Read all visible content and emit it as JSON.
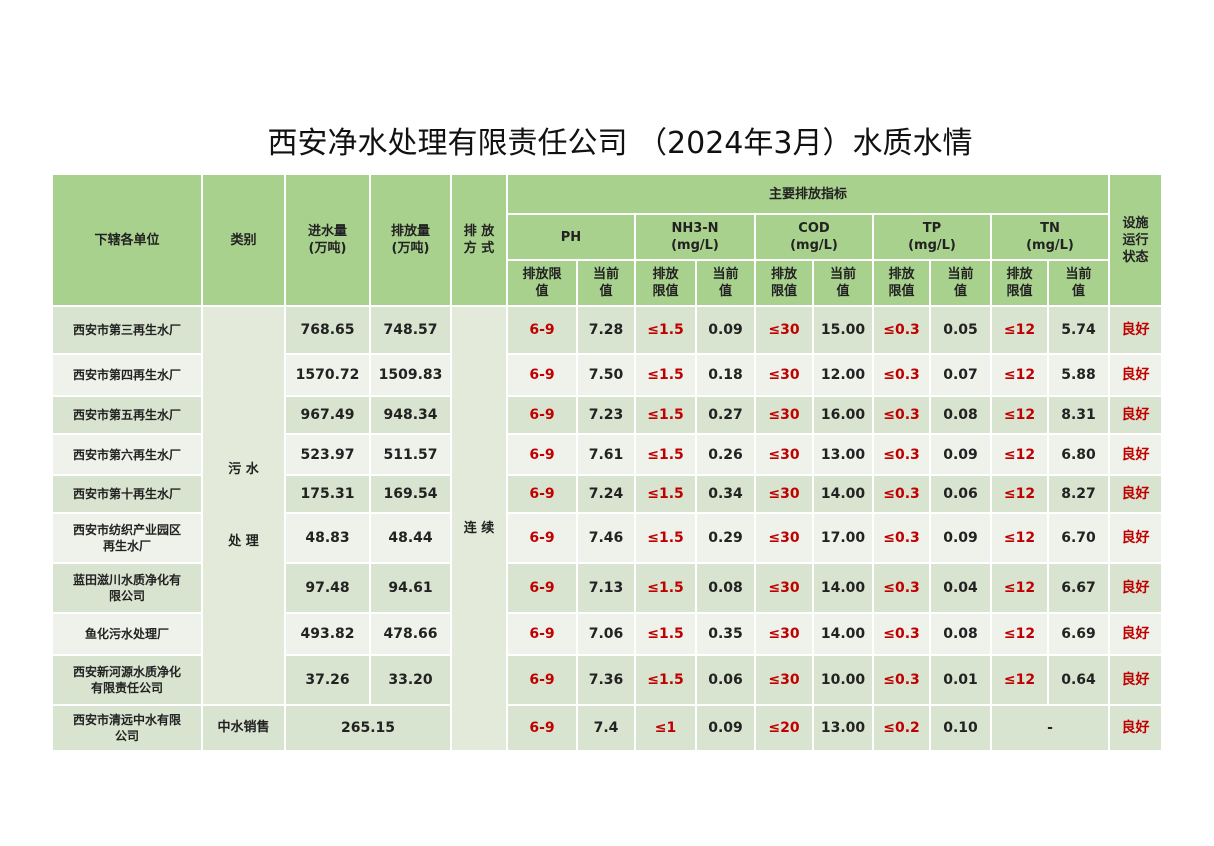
{
  "title": "西安净水处理有限责任公司 （2024年3月）水质水情",
  "headers": {
    "unit": "下辖各单位",
    "category": "类别",
    "inflow": "进水量\n(万吨)",
    "discharge": "排放量\n(万吨)",
    "mode": "排 放\n方 式",
    "indicators": "主要排放指标",
    "ph": "PH",
    "nh3n": "NH3-N\n(mg/L)",
    "cod": "COD\n(mg/L)",
    "tp": "TP\n(mg/L)",
    "tn": "TN\n(mg/L)",
    "status": "设施\n运行\n状态",
    "limit": "排放限\n值",
    "limit2": "排放\n限值",
    "current": "当前\n值"
  },
  "category_sewage": "污 水\n\n处 理",
  "mode_value": "连  续",
  "rows": [
    {
      "unit": "西安市第三再生水厂",
      "inflow": "768.65",
      "discharge": "748.57",
      "ph_lim": "6-9",
      "ph": "7.28",
      "nh_lim": "≤1.5",
      "nh": "0.09",
      "cod_lim": "≤30",
      "cod": "15.00",
      "tp_lim": "≤0.3",
      "tp": "0.05",
      "tn_lim": "≤12",
      "tn": "5.74",
      "status": "良好"
    },
    {
      "unit": "西安市第四再生水厂",
      "inflow": "1570.72",
      "discharge": "1509.83",
      "ph_lim": "6-9",
      "ph": "7.50",
      "nh_lim": "≤1.5",
      "nh": "0.18",
      "cod_lim": "≤30",
      "cod": "12.00",
      "tp_lim": "≤0.3",
      "tp": "0.07",
      "tn_lim": "≤12",
      "tn": "5.88",
      "status": "良好"
    },
    {
      "unit": "西安市第五再生水厂",
      "inflow": "967.49",
      "discharge": "948.34",
      "ph_lim": "6-9",
      "ph": "7.23",
      "nh_lim": "≤1.5",
      "nh": "0.27",
      "cod_lim": "≤30",
      "cod": "16.00",
      "tp_lim": "≤0.3",
      "tp": "0.08",
      "tn_lim": "≤12",
      "tn": "8.31",
      "status": "良好"
    },
    {
      "unit": "西安市第六再生水厂",
      "inflow": "523.97",
      "discharge": "511.57",
      "ph_lim": "6-9",
      "ph": "7.61",
      "nh_lim": "≤1.5",
      "nh": "0.26",
      "cod_lim": "≤30",
      "cod": "13.00",
      "tp_lim": "≤0.3",
      "tp": "0.09",
      "tn_lim": "≤12",
      "tn": "6.80",
      "status": "良好"
    },
    {
      "unit": "西安市第十再生水厂",
      "inflow": "175.31",
      "discharge": "169.54",
      "ph_lim": "6-9",
      "ph": "7.24",
      "nh_lim": "≤1.5",
      "nh": "0.34",
      "cod_lim": "≤30",
      "cod": "14.00",
      "tp_lim": "≤0.3",
      "tp": "0.06",
      "tn_lim": "≤12",
      "tn": "8.27",
      "status": "良好"
    },
    {
      "unit": "西安市纺织产业园区\n再生水厂",
      "inflow": "48.83",
      "discharge": "48.44",
      "ph_lim": "6-9",
      "ph": "7.46",
      "nh_lim": "≤1.5",
      "nh": "0.29",
      "cod_lim": "≤30",
      "cod": "17.00",
      "tp_lim": "≤0.3",
      "tp": "0.09",
      "tn_lim": "≤12",
      "tn": "6.70",
      "status": "良好"
    },
    {
      "unit": "蓝田滋川水质净化有\n限公司",
      "inflow": "97.48",
      "discharge": "94.61",
      "ph_lim": "6-9",
      "ph": "7.13",
      "nh_lim": "≤1.5",
      "nh": "0.08",
      "cod_lim": "≤30",
      "cod": "14.00",
      "tp_lim": "≤0.3",
      "tp": "0.04",
      "tn_lim": "≤12",
      "tn": "6.67",
      "status": "良好"
    },
    {
      "unit": "鱼化污水处理厂",
      "inflow": "493.82",
      "discharge": "478.66",
      "ph_lim": "6-9",
      "ph": "7.06",
      "nh_lim": "≤1.5",
      "nh": "0.35",
      "cod_lim": "≤30",
      "cod": "14.00",
      "tp_lim": "≤0.3",
      "tp": "0.08",
      "tn_lim": "≤12",
      "tn": "6.69",
      "status": "良好"
    },
    {
      "unit": "西安新河源水质净化\n有限责任公司",
      "inflow": "37.26",
      "discharge": "33.20",
      "ph_lim": "6-9",
      "ph": "7.36",
      "nh_lim": "≤1.5",
      "nh": "0.06",
      "cod_lim": "≤30",
      "cod": "10.00",
      "tp_lim": "≤0.3",
      "tp": "0.01",
      "tn_lim": "≤12",
      "tn": "0.64",
      "status": "良好"
    }
  ],
  "last_row": {
    "unit": "西安市清远中水有限\n公司",
    "category": "中水销售",
    "volume": "265.15",
    "ph_lim": "6-9",
    "ph": "7.4",
    "nh_lim": "≤1",
    "nh": "0.09",
    "cod_lim": "≤20",
    "cod": "13.00",
    "tp_lim": "≤0.2",
    "tp": "0.10",
    "tn": "-",
    "status": "良好"
  }
}
